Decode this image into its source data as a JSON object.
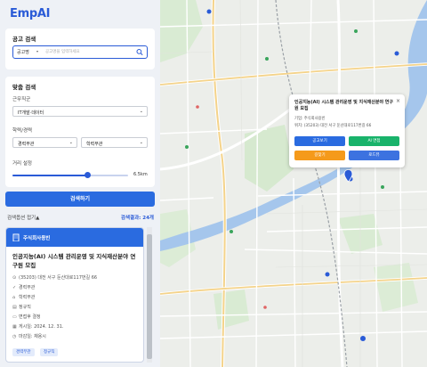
{
  "app": {
    "logo": "EmpAI"
  },
  "search": {
    "title": "공고 검색",
    "category": "공고명",
    "placeholder": "공고명을 입력하세요"
  },
  "filter": {
    "title": "맞춤 검색",
    "job_label": "근무직군",
    "job_value": "IT개발·데이터",
    "edu_label": "학력/경력",
    "career_value": "경력무관",
    "edu_value": "학력무관",
    "distance_label": "거리 설정",
    "distance_value": "6.5km",
    "distance_fraction": 0.65
  },
  "search_button": "검색하기",
  "options_toggle": "검색옵션 접기▲",
  "result_count": "검색결과: 24개",
  "result": {
    "company": "주식회사용빈",
    "title": "인공지능(AI) 시스템 관리운영 및 지식재산분야 연구원 모집",
    "address": "(35203) 대전 서구 둔산대로117번길 66",
    "career": "경력무관",
    "education": "학력무관",
    "employment": "정규직",
    "salary": "면접후 결정",
    "posted": "게시일: 2024. 12. 31.",
    "deadline": "마감일: 채용시",
    "tags": [
      "경력무관",
      "정규직"
    ]
  },
  "popup": {
    "title": "인공지능(AI) 시스템 관리운영 및 지식재산분야 연구원 모집",
    "company": "기업: 주식회사용빈",
    "location": "위치: (35203) 대전 서구 둔산대로117번길 66",
    "close": "×",
    "buttons": [
      {
        "label": "공고보기",
        "color": "#2a6be0"
      },
      {
        "label": "AI 면접",
        "color": "#19b36b"
      },
      {
        "label": "길찾기",
        "color": "#f59a1b"
      },
      {
        "label": "로드뷰",
        "color": "#3c72e0"
      }
    ]
  },
  "colors": {
    "accent": "#2a5bd7",
    "river": "#9fc0ea",
    "park": "#cfe6c9"
  },
  "icons": {
    "search": "search-icon",
    "building": "building-icon",
    "location": "location-pin-icon",
    "career": "check-icon",
    "education": "cap-icon",
    "employment": "clipboard-icon",
    "salary": "money-icon",
    "calendar": "calendar-icon"
  }
}
